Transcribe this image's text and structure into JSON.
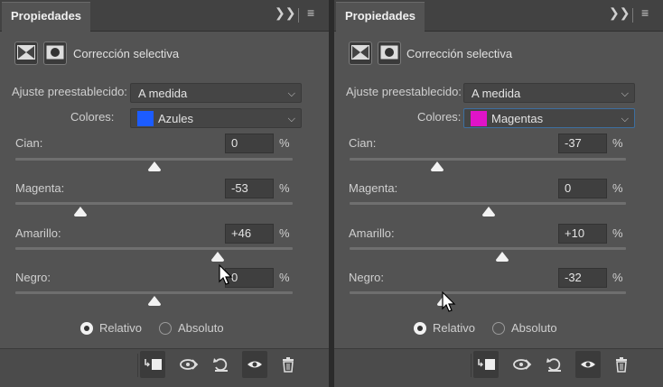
{
  "panels": [
    {
      "tab_title": "Propiedades",
      "header_icons": [
        "expand-panel-icon",
        "panel-menu-icon"
      ],
      "title": "Corrección selectiva",
      "preset_label": "Ajuste preestablecido:",
      "preset_value": "A medida",
      "colors_label": "Colores:",
      "colors_value": "Azules",
      "swatch_color": "#1c5cff",
      "sliders": [
        {
          "label": "Cian:",
          "value": "0",
          "unit": "%",
          "level": 0
        },
        {
          "label": "Magenta:",
          "value": "-53",
          "unit": "%",
          "level": -53
        },
        {
          "label": "Amarillo:",
          "value": "+46",
          "unit": "%",
          "level": 46
        },
        {
          "label": "Negro:",
          "value": "0",
          "unit": "%",
          "level": 0
        }
      ],
      "radio_relative": "Relativo",
      "radio_absolute": "Absoluto",
      "method_selected": "Relativo",
      "footer_icons": [
        "clip-to-layer-icon",
        "view-previous-icon",
        "reset-icon",
        "visibility-eye-icon",
        "trash-icon"
      ]
    },
    {
      "tab_title": "Propiedades",
      "header_icons": [
        "expand-panel-icon",
        "panel-menu-icon"
      ],
      "title": "Corrección selectiva",
      "preset_label": "Ajuste preestablecido:",
      "preset_value": "A medida",
      "colors_label": "Colores:",
      "colors_value": "Magentas",
      "swatch_color": "#e013c8",
      "sliders": [
        {
          "label": "Cian:",
          "value": "-37",
          "unit": "%",
          "level": -37
        },
        {
          "label": "Magenta:",
          "value": "0",
          "unit": "%",
          "level": 0
        },
        {
          "label": "Amarillo:",
          "value": "+10",
          "unit": "%",
          "level": 10
        },
        {
          "label": "Negro:",
          "value": "-32",
          "unit": "%",
          "level": -32
        }
      ],
      "radio_relative": "Relativo",
      "radio_absolute": "Absoluto",
      "method_selected": "Relativo",
      "footer_icons": [
        "clip-to-layer-icon",
        "view-previous-icon",
        "reset-icon",
        "visibility-eye-icon",
        "trash-icon"
      ]
    }
  ]
}
